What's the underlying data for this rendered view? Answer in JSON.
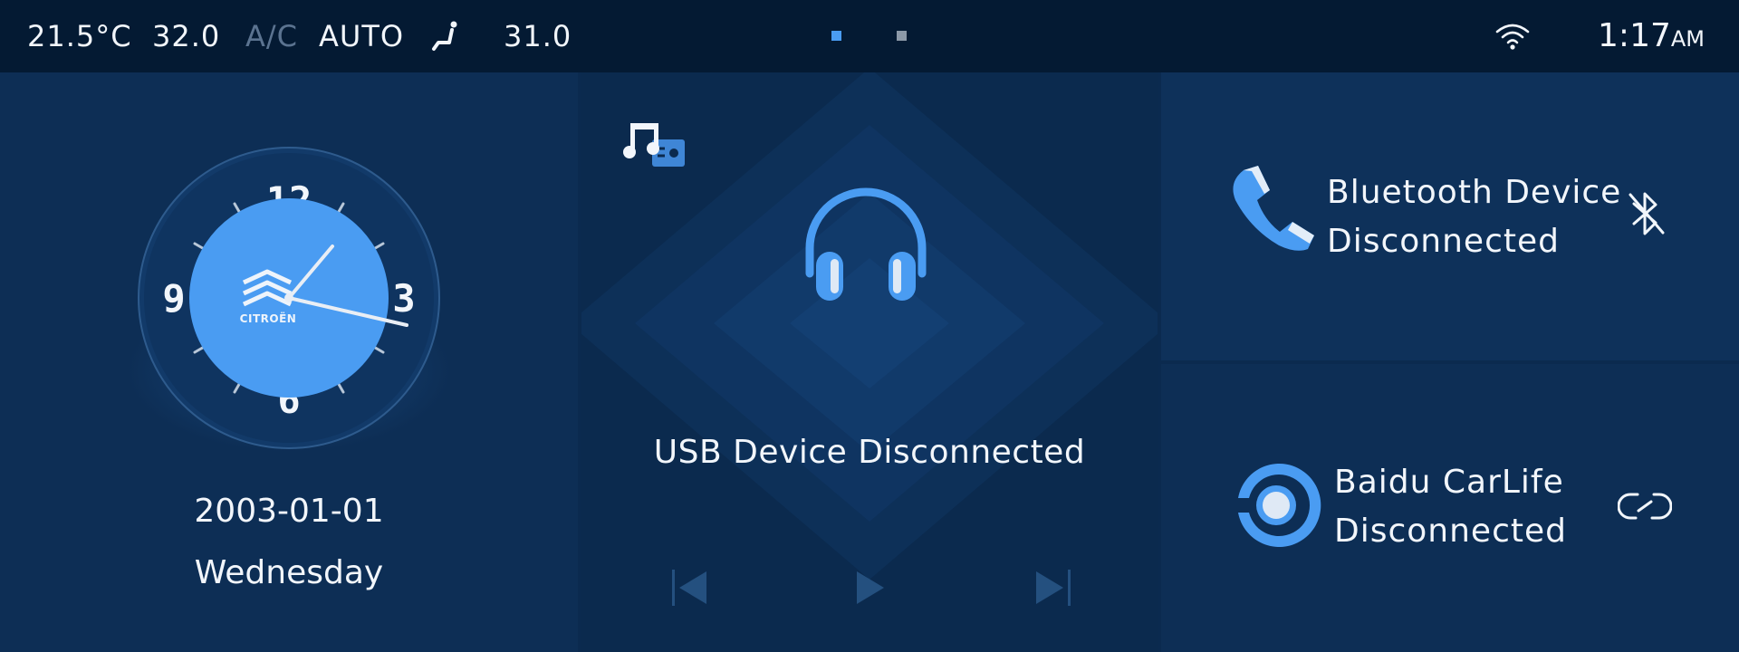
{
  "status_bar": {
    "temperature_left": "21.5°C",
    "fan_value": "32.0",
    "ac_label": "A/C",
    "mode_label": "AUTO",
    "seat_icon": "seat-heat-icon",
    "temperature_right": "31.0",
    "page_indicator": {
      "pages": 2,
      "active": 1
    },
    "wifi_icon": "wifi-icon",
    "time": "1:17",
    "ampm": "AM"
  },
  "clock_panel": {
    "brand": "CITROËN",
    "dial_numerals": [
      "12",
      "3",
      "6",
      "9"
    ],
    "date": "2003-01-01",
    "weekday": "Wednesday",
    "time_shown": "1:17"
  },
  "media_panel": {
    "source_icon": "music-radio-icon",
    "device_icon": "headphones-icon",
    "status": "USB Device Disconnected",
    "controls": [
      "previous-icon",
      "play-icon",
      "next-icon"
    ]
  },
  "bluetooth_card": {
    "icon": "phone-icon",
    "line1": "Bluetooth Device",
    "line2": "Disconnected",
    "status_icon": "bluetooth-disabled-icon"
  },
  "carlife_card": {
    "icon": "carlife-icon",
    "line1": "Baidu CarLife",
    "line2": "Disconnected",
    "status_icon": "link-broken-icon"
  },
  "colors": {
    "accent": "#4a9cf2",
    "background": "#0b2a4f",
    "status_bar": "#041a33",
    "dim_text": "#5b7390"
  }
}
